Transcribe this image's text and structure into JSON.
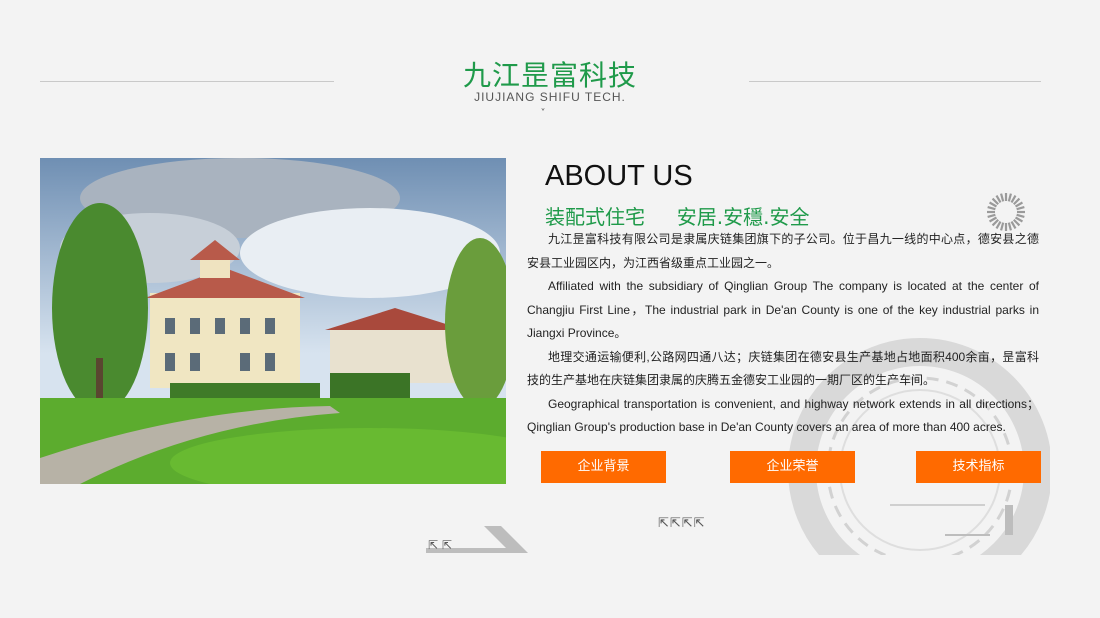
{
  "header": {
    "title_cn": "九江昰富科技",
    "title_en": "JIUJIANG SHIFU TECH.",
    "chevron": "˅"
  },
  "about": {
    "title": "ABOUT US",
    "subtitle": "装配式住宅     安居.安穩.安全",
    "paragraphs": [
      "九江昰富科技有限公司是隶属庆链集团旗下的子公司。位于昌九一线的中心点，德安县之德安县工业园区内，为江西省级重点工业园之一。",
      "Affiliated with the subsidiary of Qinglian Group The company is located at the center of Changjiu First Line，The industrial park in De'an County is one of the key industrial parks in Jiangxi Province。",
      "地理交通运输便利,公路网四通八达；庆链集团在德安县生产基地占地面积400余亩，昰富科技的生产基地在庆链集团隶属的庆腾五金德安工业园的一期厂区的生产车间。",
      "Geographical transportation is convenient, and highway network extends in all directions；Qinglian Group's production base in De'an County covers an area of more than 400 acres."
    ]
  },
  "buttons": {
    "background": "企业背景",
    "honors": "企业荣誉",
    "tech": "技术指标"
  },
  "decor": {
    "arrows_left": "⇱ ⇱",
    "arrows_mid": "⇱⇱⇱⇱"
  },
  "colors": {
    "brand_green": "#1f9a4a",
    "button_orange": "#ff6a00",
    "page_bg": "#f3f3f3"
  }
}
